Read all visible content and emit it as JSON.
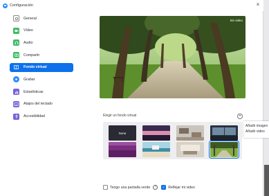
{
  "window": {
    "title": "Configuración",
    "close_glyph": "×"
  },
  "sidebar": {
    "items": [
      {
        "label": "General",
        "icon": "gear-icon",
        "color": "#ffffff"
      },
      {
        "label": "Vídeo",
        "icon": "video-icon",
        "color": "#3dbb62"
      },
      {
        "label": "Audio",
        "icon": "headphones-icon",
        "color": "#3dbb62"
      },
      {
        "label": "Compartir",
        "icon": "share-screen-icon",
        "color": "#3dbb62"
      },
      {
        "label": "Fondo virtual",
        "icon": "person-background-icon",
        "color": "#ffffff"
      },
      {
        "label": "Grabar",
        "icon": "record-icon",
        "color": "#2d8cff"
      },
      {
        "label": "Estadísticas",
        "icon": "stats-icon",
        "color": "#7b61d9"
      },
      {
        "label": "Atajos del teclado",
        "icon": "keyboard-icon",
        "color": "#7b61d9"
      },
      {
        "label": "Accesibilidad",
        "icon": "accessibility-icon",
        "color": "#7b61d9"
      }
    ],
    "active_index": 4
  },
  "preview": {
    "overlay_label": "Sin video"
  },
  "backgrounds": {
    "section_label": "Elegir un fondo virtual",
    "add_glyph": "+",
    "none_label": "None",
    "thumbnails": [
      {
        "name": "none-thumbnail"
      },
      {
        "name": "thumb-pink-sky"
      },
      {
        "name": "thumb-office"
      },
      {
        "name": "thumb-city-night"
      },
      {
        "name": "thumb-purple-field"
      },
      {
        "name": "thumb-beach"
      },
      {
        "name": "thumb-lobby"
      },
      {
        "name": "thumb-park"
      }
    ],
    "selected_index": 7,
    "menu": [
      "Añadir imagen",
      "Añadir video"
    ]
  },
  "footer": {
    "green_screen_label": "Tengo una pantalla verde",
    "green_screen_checked": false,
    "mirror_label": "Reflejar mi video",
    "mirror_checked": true
  },
  "colors": {
    "accent": "#0e71eb"
  }
}
